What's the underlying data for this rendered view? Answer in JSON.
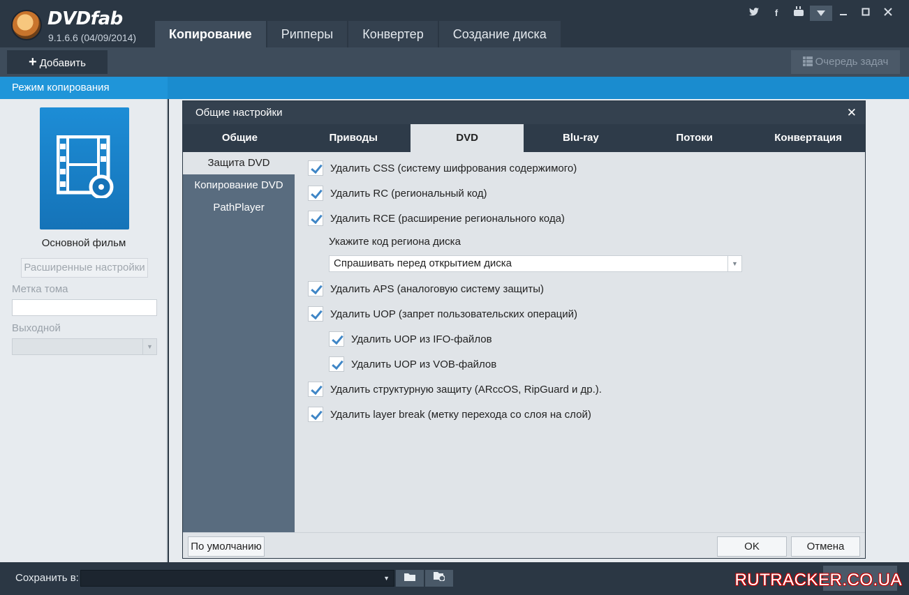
{
  "app": {
    "brand": "DVDfab",
    "version": "9.1.6.6 (04/09/2014)"
  },
  "main_tabs": [
    {
      "label": "Копирование",
      "active": true
    },
    {
      "label": "Рипперы",
      "active": false
    },
    {
      "label": "Конвертер",
      "active": false
    },
    {
      "label": "Создание диска",
      "active": false
    }
  ],
  "window_controls": {
    "icons": [
      "twitter-icon",
      "facebook-icon",
      "youtube-icon",
      "dropdown-icon",
      "minimize-icon",
      "maximize-icon",
      "close-icon"
    ]
  },
  "toolbar": {
    "add_label": "Добавить",
    "queue_label": "Очередь задач"
  },
  "mode_bar": {
    "label": "Режим копирования"
  },
  "left_panel": {
    "movie_label": "Основной фильм",
    "advanced_button": "Расширенные настройки",
    "volume_label": "Метка тома",
    "volume_value": "",
    "output_label": "Выходной",
    "output_value": ""
  },
  "dialog": {
    "title": "Общие настройки",
    "tabs": [
      {
        "label": "Общие",
        "active": false
      },
      {
        "label": "Приводы",
        "active": false
      },
      {
        "label": "DVD",
        "active": true
      },
      {
        "label": "Blu-ray",
        "active": false
      },
      {
        "label": "Потоки",
        "active": false
      },
      {
        "label": "Конвертация",
        "active": false
      }
    ],
    "side_items": [
      {
        "label": "Защита DVD",
        "active": true
      },
      {
        "label": "Копирование DVD",
        "active": false
      },
      {
        "label": "PathPlayer",
        "active": false
      }
    ],
    "options": [
      {
        "label": "Удалить CSS (систему шифрования содержимого)",
        "checked": true,
        "indent": 0
      },
      {
        "label": "Удалить RC (региональный код)",
        "checked": true,
        "indent": 0
      },
      {
        "label": "Удалить RCE (расширение регионального кода)",
        "checked": true,
        "indent": 0
      },
      {
        "label": "Удалить APS (аналоговую систему защиты)",
        "checked": true,
        "indent": 0
      },
      {
        "label": "Удалить UOP (запрет пользовательских операций)",
        "checked": true,
        "indent": 0
      },
      {
        "label": "Удалить UOP из IFO-файлов",
        "checked": true,
        "indent": 1
      },
      {
        "label": "Удалить UOP из VOB-файлов",
        "checked": true,
        "indent": 1
      },
      {
        "label": "Удалить структурную защиту (ARccOS, RipGuard и др.).",
        "checked": true,
        "indent": 0
      },
      {
        "label": "Удалить layer break (метку перехода со слоя на слой)",
        "checked": true,
        "indent": 0
      }
    ],
    "region_label": "Укажите код региона диска",
    "region_value": "Спрашивать перед открытием диска",
    "default_button": "По умолчанию",
    "ok_button": "OK",
    "cancel_button": "Отмена"
  },
  "bottom_bar": {
    "save_label": "Сохранить в:",
    "save_value": "",
    "watermark": "RUTRACKER.CO.UA"
  },
  "colors": {
    "dark_bg": "#2b3744",
    "accent_blue": "#1a8ccf",
    "tile_blue": "#1d8dd6",
    "check_blue": "#3f86c6",
    "panel_bg": "#e7ebef"
  }
}
